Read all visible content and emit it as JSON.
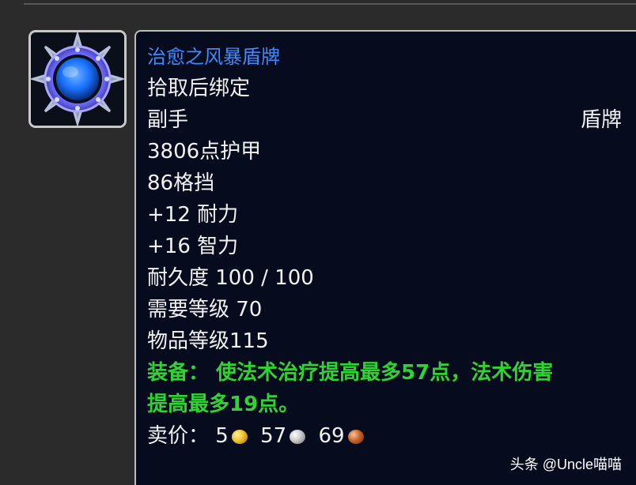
{
  "item": {
    "name": "治愈之风暴盾牌",
    "binding": "拾取后绑定",
    "slot": "副手",
    "type": "盾牌",
    "armor": "3806点护甲",
    "block": "86格挡",
    "stamina": "+12 耐力",
    "intellect": "+16 智力",
    "durability": "耐久度 100 / 100",
    "required_level": "需要等级 70",
    "item_level": "物品等级115",
    "equip_line1": "装备： 使法术治疗提高最多57点，法术伤害",
    "equip_line2": "提高最多19点。",
    "sell_label": "卖价：",
    "sell_gold": "5",
    "sell_silver": "57",
    "sell_copper": "69"
  },
  "icon": {
    "name": "storm-shield-icon",
    "colors": {
      "rim": "#6f6cff",
      "core": "#1a73ff",
      "spikes": "#b7c0d9"
    }
  },
  "watermark": "头条 @Uncle喵喵",
  "colors": {
    "tooltip_bg": "#070b1e",
    "item_name": "#3d8cff",
    "equip_text": "#2fd52f",
    "text": "#f2f2f2"
  }
}
